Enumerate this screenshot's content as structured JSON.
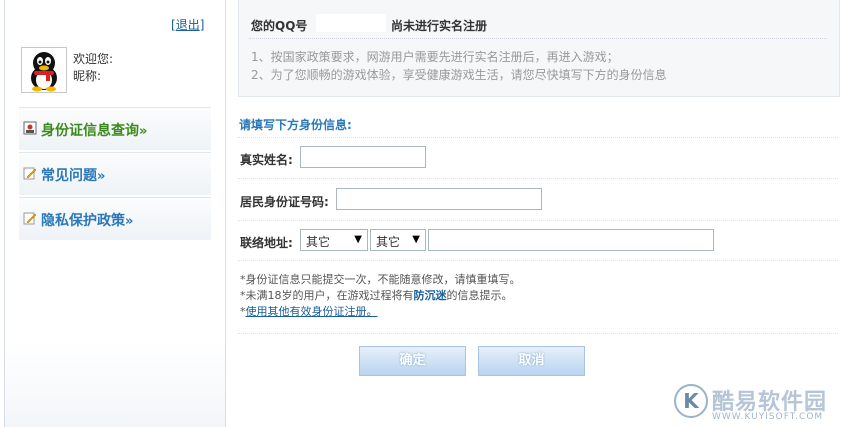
{
  "sidebar": {
    "logout": "退出",
    "user": {
      "welcome": "欢迎您:",
      "nickname": "昵称:"
    },
    "nav": [
      {
        "label": "身份证信息查询",
        "arrow": "»"
      },
      {
        "label": "常见问题",
        "arrow": "»"
      },
      {
        "label": "隐私保护政策",
        "arrow": "»"
      }
    ]
  },
  "notice": {
    "title_prefix": "您的QQ号",
    "title_suffix": "尚未进行实名注册",
    "line1": "1、按国家政策要求，网游用户需要先进行实名注册后，再进入游戏；",
    "line2": "2、为了您顺畅的游戏体验，享受健康游戏生活，请您尽快填写下方的身份信息"
  },
  "form": {
    "title": "请填写下方身份信息:",
    "name_label": "真实姓名:",
    "id_label": "居民身份证号码:",
    "address_label": "联络地址:",
    "province": "其它",
    "city": "其它",
    "notes": {
      "n1": "*身份证信息只能提交一次，不能随意修改，请慎重填写。",
      "n2_pre": "*未满18岁的用户，在游戏过程将有",
      "n2_bold": "防沉迷",
      "n2_post": "的信息提示。",
      "n3_star": "*",
      "n3_link": "使用其他有效身份证注册。"
    },
    "confirm": "确定",
    "cancel": "取消"
  },
  "watermark": {
    "logo": "K",
    "text": "酷易软件园",
    "url": "WWW.KUYISOFT.COM"
  },
  "colors": {
    "link": "#1a5e9a",
    "nav_green": "#3c8a1c",
    "nav_blue": "#2a78b8",
    "button": "#b9d3ef"
  }
}
